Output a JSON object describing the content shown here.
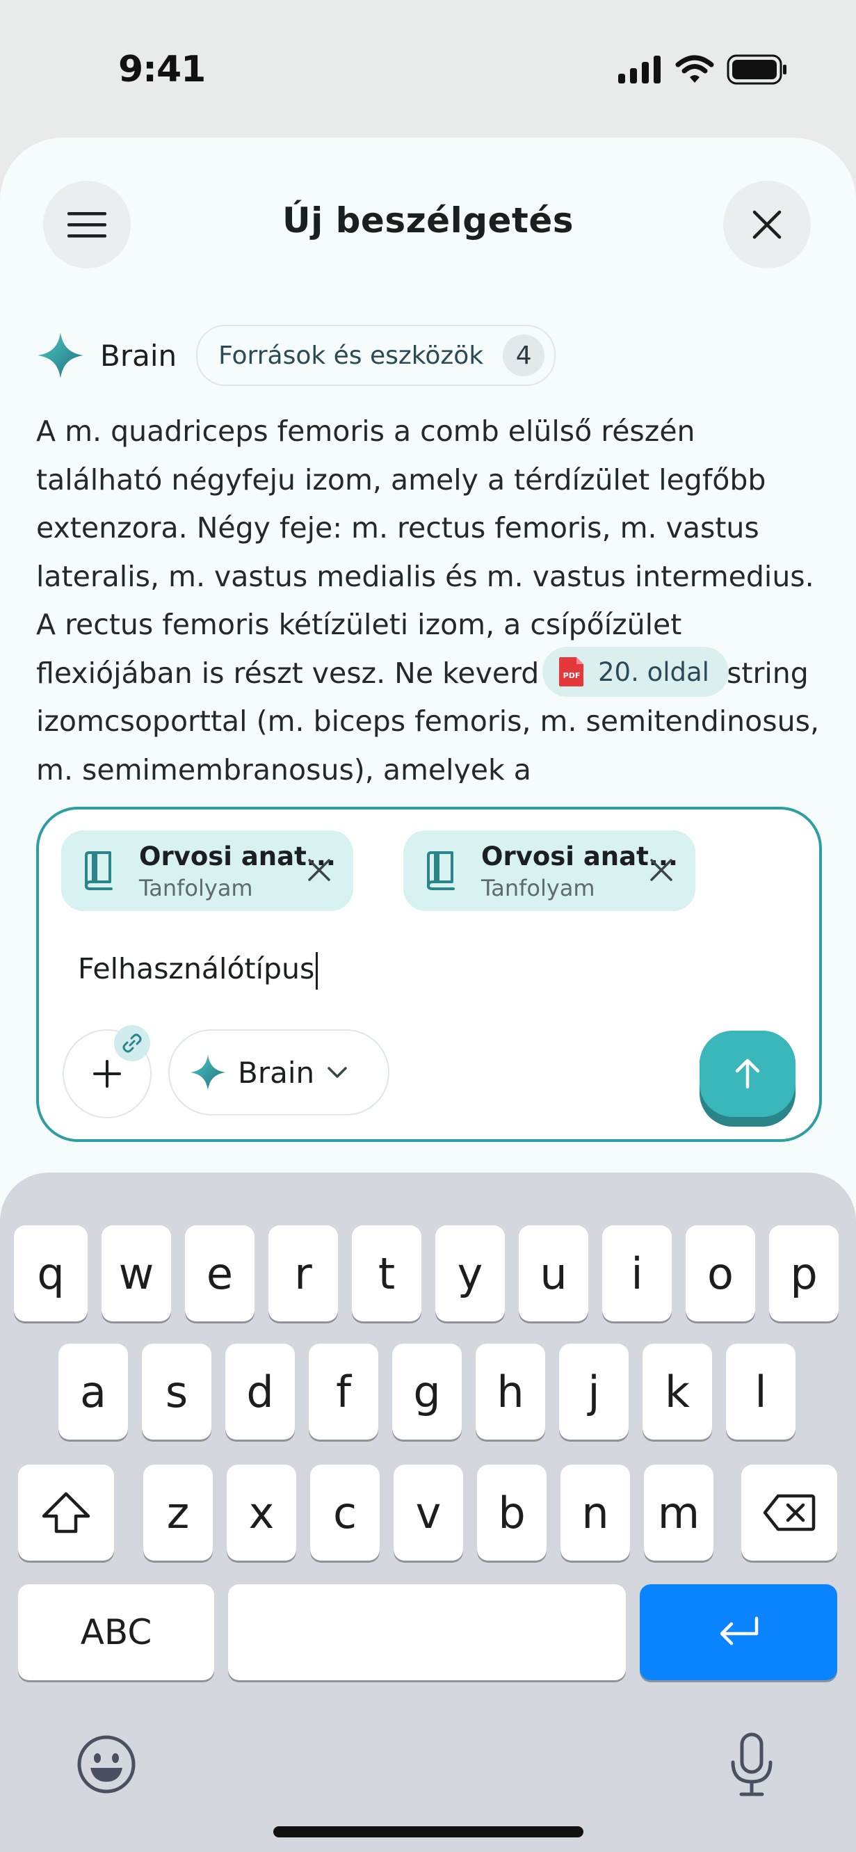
{
  "status_bar": {
    "time": "9:41"
  },
  "header": {
    "title": "Új beszélgetés",
    "menu_icon": "hamburger-menu-icon",
    "close_icon": "close-icon"
  },
  "assistant": {
    "name": "Brain",
    "sources_label": "Források és eszközök",
    "sources_count": "4",
    "accent": "#2e9ea3"
  },
  "response": {
    "text": "A m. quadriceps femoris a comb elülső részén található négyfeju izom, amely a térdízület legfőbb extenzora. Négy feje: m. rectus femoris, m. vastus lateralis, m. vastus medialis és m. vastus intermedius. A rectus femoris kétízületi izom, a csípőízület flexiójában is részt vesz. Ne keverd össze a hamstring izomcsoporttal (m. biceps femoris, m. semitendinosus, m. semimembranosus), amelyek a",
    "citation": {
      "icon": "pdf-icon",
      "label": "20. oldal"
    }
  },
  "composer": {
    "attachments": [
      {
        "title": "Orvosi anat...",
        "subtitle": "Tanfolyam",
        "icon": "book-icon"
      },
      {
        "title": "Orvosi anat...",
        "subtitle": "Tanfolyam",
        "icon": "book-icon"
      }
    ],
    "input_value": "Felhasználótípus",
    "model": "Brain",
    "send_color": "#3ab7bb"
  },
  "keyboard": {
    "row1": [
      "q",
      "w",
      "e",
      "r",
      "t",
      "y",
      "u",
      "i",
      "o",
      "p"
    ],
    "row2": [
      "a",
      "s",
      "d",
      "f",
      "g",
      "h",
      "j",
      "k",
      "l"
    ],
    "row3": [
      "z",
      "x",
      "c",
      "v",
      "b",
      "n",
      "m"
    ],
    "abc_label": "ABC",
    "return_color": "#0a84ff"
  }
}
